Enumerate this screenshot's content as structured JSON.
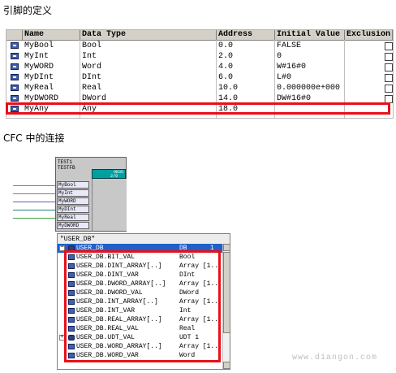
{
  "heading_top": "引脚的定义",
  "heading_cfc": "CFC 中的连接",
  "table": {
    "headers": [
      "Name",
      "Data Type",
      "Address",
      "Initial Value",
      "Exclusion"
    ],
    "rows": [
      {
        "name": "MyBool",
        "type": "Bool",
        "address": "0.0",
        "initial": "FALSE"
      },
      {
        "name": "MyInt",
        "type": "Int",
        "address": "2.0",
        "initial": "0"
      },
      {
        "name": "MyWORD",
        "type": "Word",
        "address": "4.0",
        "initial": "W#16#0"
      },
      {
        "name": "MyDInt",
        "type": "DInt",
        "address": "6.0",
        "initial": "L#0"
      },
      {
        "name": "MyReal",
        "type": "Real",
        "address": "10.0",
        "initial": "0.000000e+000"
      },
      {
        "name": "MyDWORD",
        "type": "DWord",
        "address": "14.0",
        "initial": "DW#16#0"
      },
      {
        "name": "MyAny",
        "type": "Any",
        "address": "18.0",
        "initial": ""
      }
    ]
  },
  "cfc_block": {
    "title1": "TEST1",
    "title2": "TESTFB",
    "green_top": "OB35",
    "green_bottom": "2/9",
    "pins": [
      "MyBool",
      "MyInt",
      "MyWORD",
      "MyDInt",
      "MyReal",
      "MyDWORD",
      "MyAny"
    ]
  },
  "popup": {
    "title": "\"USER_DB\"",
    "root": {
      "name": "USER_DB",
      "type": "DB",
      "num": "1"
    },
    "items": [
      {
        "name": "USER_DB.BIT_VAL",
        "type": "Bool"
      },
      {
        "name": "USER_DB.DINT_ARRAY[..]",
        "type": "Array [1.."
      },
      {
        "name": "USER_DB.DINT_VAR",
        "type": "DInt"
      },
      {
        "name": "USER_DB.DWORD_ARRAY[..]",
        "type": "Array [1.."
      },
      {
        "name": "USER_DB.DWORD_VAL",
        "type": "DWord"
      },
      {
        "name": "USER_DB.INT_ARRAY[..]",
        "type": "Array [1.."
      },
      {
        "name": "USER_DB.INT_VAR",
        "type": "Int"
      },
      {
        "name": "USER_DB.REAL_ARRAY[..]",
        "type": "Array [1.."
      },
      {
        "name": "USER_DB.REAL_VAL",
        "type": "Real"
      },
      {
        "name": "USER_DB.UDT_VAL",
        "type": "UDT 1"
      },
      {
        "name": "USER_DB.WORD_ARRAY[..]",
        "type": "Array [1.."
      },
      {
        "name": "USER_DB.WORD_VAR",
        "type": "Word"
      }
    ]
  },
  "watermark": "www.diangon.com",
  "colors": {
    "highlight": "#e8101a",
    "selection": "#2060c8",
    "block_green": "#00a0a0"
  }
}
